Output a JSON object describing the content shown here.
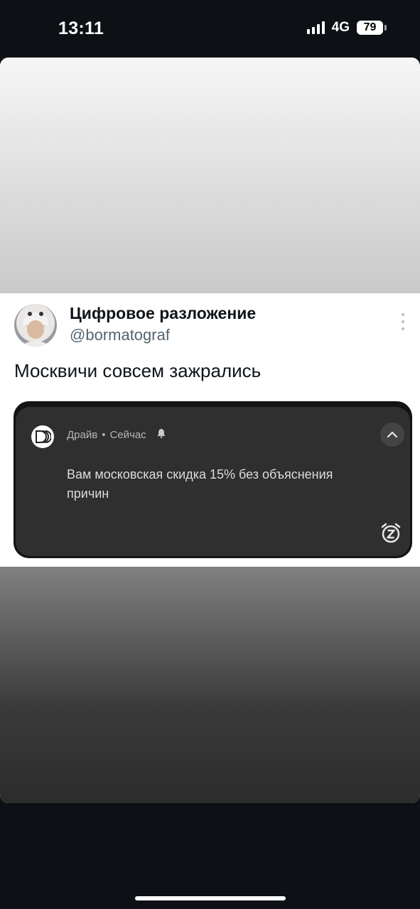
{
  "status_bar": {
    "time": "13:11",
    "network": "4G",
    "battery": "79"
  },
  "tweet": {
    "display_name": "Цифровое разложение",
    "handle": "@bormatograf",
    "text": "Москвичи совсем зажрались"
  },
  "notification": {
    "app_name": "Драйв",
    "separator": "•",
    "time": "Сейчас",
    "body": "Вам московская скидка 15% без объяснения причин",
    "icons": {
      "app": "app-logo-icon",
      "bell": "bell-icon",
      "expand": "chevron-up-icon",
      "snooze": "snooze-alarm-icon"
    }
  },
  "colors": {
    "background": "#0d1015",
    "notification_bg": "#2f2f2f",
    "handle": "#536471"
  }
}
